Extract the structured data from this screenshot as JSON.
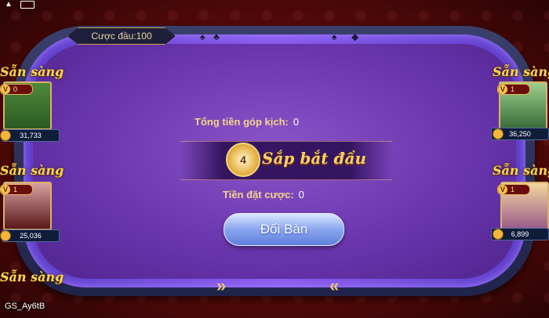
{
  "header": {
    "bet_label": "Cược đầu:100"
  },
  "table": {
    "total_pot_label": "Tổng tiền góp kịch:",
    "total_pot_value": "0",
    "countdown": "4",
    "start_text": "Sắp bắt đầu",
    "bet_label": "Tiền đặt cược:",
    "bet_value": "0",
    "change_table_button": "Đổi Bàn"
  },
  "players": [
    {
      "status": "Sẵn sàng",
      "level": "0",
      "coins": "31,733"
    },
    {
      "status": "Sẵn sàng",
      "level": "1",
      "coins": "25,036"
    },
    {
      "status": "Sẵn sàng"
    },
    {
      "status": "Sẵn sàng",
      "level": "1",
      "coins": "36,250"
    },
    {
      "status": "Sẵn sàng",
      "level": "1",
      "coins": "6,899"
    }
  ],
  "footer": {
    "game_id": "GS_Ay6tB"
  }
}
